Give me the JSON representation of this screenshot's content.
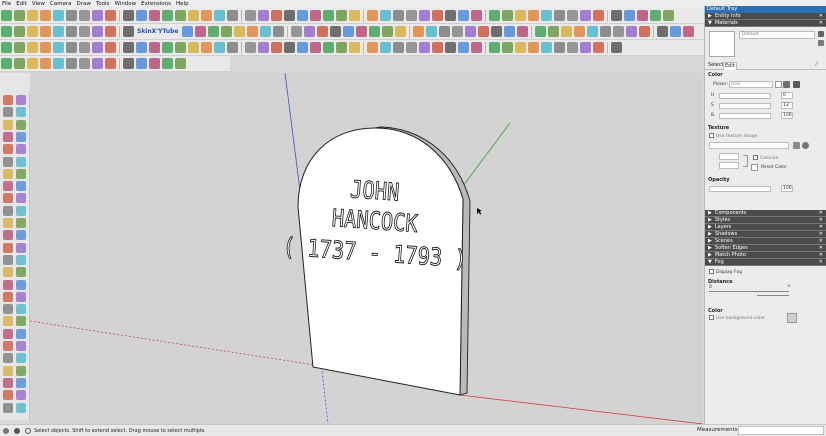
{
  "menu": [
    "File",
    "Edit",
    "View",
    "Camera",
    "Draw",
    "Tools",
    "Window",
    "Extensions",
    "Help"
  ],
  "toolbar": {
    "skin_label": "SkinX'YTube"
  },
  "tombstone": {
    "line1": "JOHN",
    "line2": "HANCOCK",
    "line3": "( 1737 - 1793 )"
  },
  "tray": {
    "title": "Default Tray",
    "entity_info": "Entity Info",
    "materials": "Materials",
    "material_name": "Default",
    "tab_select": "Select",
    "tab_edit": "Edit",
    "color_label": "Color",
    "picker_label": "Picker:",
    "picker_value": "HSB",
    "h_label": "H",
    "h_value": "0",
    "s_label": "S",
    "s_value": "13",
    "b_label": "B",
    "b_value": "100",
    "texture_label": "Texture",
    "use_texture": "Use texture image",
    "colorize": "Colorize",
    "reset_color": "Reset Color",
    "opacity_label": "Opacity",
    "opacity_value": "100",
    "components": "Components",
    "styles": "Styles",
    "layers": "Layers",
    "shadows": "Shadows",
    "scenes": "Scenes",
    "soften_edges": "Soften Edges",
    "match_photo": "Match Photo",
    "fog": "Fog",
    "display_fog": "Display Fog",
    "distance_label": "Distance",
    "dist_start": "0",
    "dist_end": "∞",
    "fog_color_label": "Color",
    "use_bg_color": "Use background color"
  },
  "status": {
    "text": "Select objects. Shift to extend select. Drag mouse to select multiple.",
    "measurements_label": "Measurements",
    "measurements_value": ""
  },
  "colors": {
    "axis_red": "#c83a3a",
    "axis_green": "#3aa03a",
    "axis_blue": "#3a4fcf",
    "tray_header": "#4b4b4b",
    "tray_title": "#2a6fb8"
  }
}
